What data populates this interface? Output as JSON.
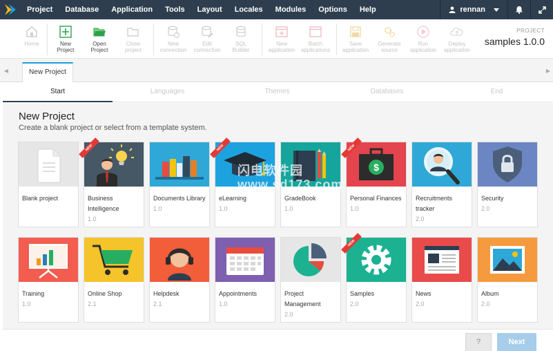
{
  "menu": {
    "items": [
      "Project",
      "Database",
      "Application",
      "Tools",
      "Layout",
      "Locales",
      "Modules",
      "Options",
      "Help"
    ],
    "user": "rennan"
  },
  "toolbar": {
    "buttons": [
      {
        "label": "Home",
        "icon": "home-icon",
        "enabled": false
      },
      {
        "label": "New\nProject",
        "icon": "plus-icon",
        "enabled": true
      },
      {
        "label": "Open\nProject",
        "icon": "folder-open-icon",
        "enabled": true
      },
      {
        "label": "Close\nproject",
        "icon": "folder-icon",
        "enabled": false
      },
      {
        "label": "New\nconnection",
        "icon": "database-add-icon",
        "enabled": false
      },
      {
        "label": "Edit\nconnection",
        "icon": "database-edit-icon",
        "enabled": false
      },
      {
        "label": "SQL\nBuilder",
        "icon": "database-sql-icon",
        "enabled": false
      },
      {
        "label": "New\napplication",
        "icon": "new-app-icon",
        "enabled": false
      },
      {
        "label": "Batch\napplications",
        "icon": "batch-icon",
        "enabled": false
      },
      {
        "label": "Save\napplication",
        "icon": "save-icon",
        "enabled": false
      },
      {
        "label": "Generate\nsource",
        "icon": "gears-icon",
        "enabled": false
      },
      {
        "label": "Run\napplication",
        "icon": "play-icon",
        "enabled": false
      },
      {
        "label": "Deploy\napplication",
        "icon": "cloud-upload-icon",
        "enabled": false
      }
    ],
    "project_label": "PROJECT",
    "project_name": "samples 1.0.0"
  },
  "tabs": {
    "active": "New Project"
  },
  "steps": [
    {
      "label": "Start",
      "active": true
    },
    {
      "label": "Languages",
      "active": false
    },
    {
      "label": "Themes",
      "active": false
    },
    {
      "label": "Databases",
      "active": false
    },
    {
      "label": "End",
      "active": false
    }
  ],
  "page": {
    "title": "New Project",
    "subtitle": "Create a blank project or select from a template system."
  },
  "watermark": "闪电软件园 www.sd173.com",
  "ribbon_text": "NEW",
  "templates": [
    {
      "name": "Blank project",
      "version": "",
      "icon": "blank-document-icon",
      "bg": "#e6e6e6",
      "is_new": false
    },
    {
      "name": "Business\nIntelligence",
      "version": "1.0",
      "icon": "businessman-lightbulb-icon",
      "bg": "#465866",
      "is_new": true
    },
    {
      "name": "Documents Library",
      "version": "1.0",
      "icon": "books-icon",
      "bg": "#2fa8d8",
      "is_new": false
    },
    {
      "name": "eLearning",
      "version": "1.0",
      "icon": "graduation-cap-icon",
      "bg": "#1da2e0",
      "is_new": true
    },
    {
      "name": "GradeBook",
      "version": "1.0",
      "icon": "gradebook-icon",
      "bg": "#16a59c",
      "is_new": false
    },
    {
      "name": "Personal Finances",
      "version": "1.0",
      "icon": "briefcase-dollar-icon",
      "bg": "#e4444d",
      "is_new": true
    },
    {
      "name": "Recruitments\ntracker",
      "version": "2.0",
      "icon": "magnifier-person-icon",
      "bg": "#2fa8d8",
      "is_new": false
    },
    {
      "name": "Security",
      "version": "2.0",
      "icon": "shield-lock-icon",
      "bg": "#6b86c3",
      "is_new": false
    },
    {
      "name": "Training",
      "version": "1.0",
      "icon": "presentation-board-icon",
      "bg": "#f25d50",
      "is_new": false
    },
    {
      "name": "Online Shop",
      "version": "2.1",
      "icon": "shopping-cart-icon",
      "bg": "#f5c32a",
      "is_new": false
    },
    {
      "name": "Helpdesk",
      "version": "2.1",
      "icon": "headset-agent-icon",
      "bg": "#f25d3a",
      "is_new": false
    },
    {
      "name": "Appointments",
      "version": "1.0",
      "icon": "calendar-icon",
      "bg": "#7e5fb0",
      "is_new": false
    },
    {
      "name": "Project\nManagement",
      "version": "2.0",
      "icon": "pie-chart-icon",
      "bg": "#e6e6e6",
      "is_new": false
    },
    {
      "name": "Samples",
      "version": "2.0",
      "icon": "gear-icon",
      "bg": "#1bb191",
      "is_new": true
    },
    {
      "name": "News",
      "version": "2.0",
      "icon": "newspaper-icon",
      "bg": "#e94b4b",
      "is_new": false
    },
    {
      "name": "Album",
      "version": "2.0",
      "icon": "picture-icon",
      "bg": "#f59a3f",
      "is_new": false
    }
  ],
  "footer": {
    "help_label": "?",
    "next_label": "Next"
  }
}
